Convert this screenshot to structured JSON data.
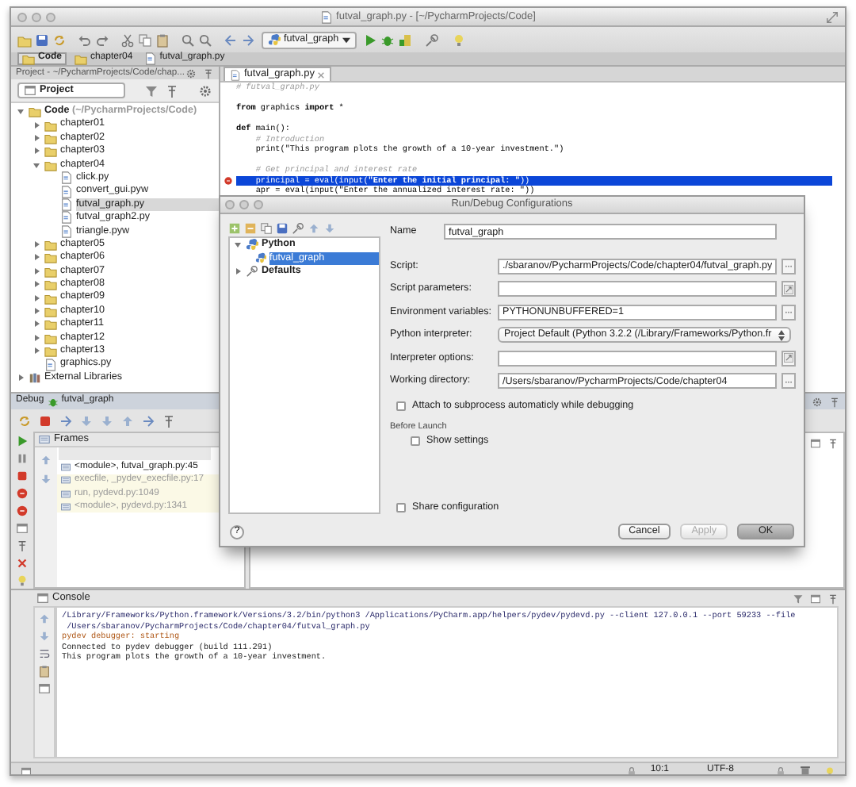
{
  "window": {
    "title": "futval_graph.py - [~/PycharmProjects/Code]"
  },
  "toolbar": {
    "run_config": "futval_graph"
  },
  "breadcrumbs": [
    {
      "label": "Code",
      "kind": "folder",
      "current": true
    },
    {
      "label": "chapter04",
      "kind": "folder",
      "current": false
    },
    {
      "label": "futval_graph.py",
      "kind": "file",
      "current": false
    }
  ],
  "project_panel": {
    "header": "Project - ~/PycharmProjects/Code/chap...",
    "view": "Project",
    "tree": [
      {
        "label": "Code",
        "note": "(~/PycharmProjects/Code)",
        "kind": "folder",
        "expanded": true,
        "selected": false,
        "children": [
          {
            "label": "chapter01",
            "kind": "folder",
            "expanded": false,
            "selected": false
          },
          {
            "label": "chapter02",
            "kind": "folder",
            "expanded": false,
            "selected": false
          },
          {
            "label": "chapter03",
            "kind": "folder",
            "expanded": false,
            "selected": false
          },
          {
            "label": "chapter04",
            "kind": "folder",
            "expanded": true,
            "selected": false,
            "children": [
              {
                "label": "click.py",
                "kind": "file",
                "selected": false
              },
              {
                "label": "convert_gui.pyw",
                "kind": "file",
                "selected": false
              },
              {
                "label": "futval_graph.py",
                "kind": "file",
                "selected": true
              },
              {
                "label": "futval_graph2.py",
                "kind": "file",
                "selected": false
              },
              {
                "label": "triangle.pyw",
                "kind": "file",
                "selected": false
              }
            ]
          },
          {
            "label": "chapter05",
            "kind": "folder",
            "expanded": false,
            "selected": false
          },
          {
            "label": "chapter06",
            "kind": "folder",
            "expanded": false,
            "selected": false
          },
          {
            "label": "chapter07",
            "kind": "folder",
            "expanded": false,
            "selected": false
          },
          {
            "label": "chapter08",
            "kind": "folder",
            "expanded": false,
            "selected": false
          },
          {
            "label": "chapter09",
            "kind": "folder",
            "expanded": false,
            "selected": false
          },
          {
            "label": "chapter10",
            "kind": "folder",
            "expanded": false,
            "selected": false
          },
          {
            "label": "chapter11",
            "kind": "folder",
            "expanded": false,
            "selected": false
          },
          {
            "label": "chapter12",
            "kind": "folder",
            "expanded": false,
            "selected": false
          },
          {
            "label": "chapter13",
            "kind": "folder",
            "expanded": false,
            "selected": false
          },
          {
            "label": "graphics.py",
            "kind": "file",
            "selected": false
          }
        ]
      },
      {
        "label": "External Libraries",
        "kind": "library",
        "expanded": false,
        "selected": false
      }
    ]
  },
  "editor": {
    "tab": "futval_graph.py",
    "lines": [
      {
        "kind": "comment",
        "text": "# futval_graph.py",
        "breakpoint": false,
        "current": false
      },
      {
        "kind": "blank"
      },
      {
        "kind": "code",
        "text": "**from** graphics **import** *",
        "breakpoint": false,
        "current": false
      },
      {
        "kind": "blank"
      },
      {
        "kind": "code",
        "text": "**def** main():",
        "breakpoint": false,
        "current": false
      },
      {
        "kind": "comment",
        "text": "    # Introduction",
        "breakpoint": false,
        "current": false
      },
      {
        "kind": "code",
        "text": "    print(\"This program plots the growth of a 10-year investment.\")",
        "breakpoint": false,
        "current": false
      },
      {
        "kind": "blank"
      },
      {
        "kind": "comment",
        "text": "    # Get principal and interest rate",
        "breakpoint": false,
        "current": false
      },
      {
        "kind": "code",
        "text": "    principal = eval(input(**\"Enter the initial principal: \"**))",
        "breakpoint": true,
        "current": true
      },
      {
        "kind": "code",
        "text": "    apr = eval(input(\"Enter the annualized interest rate: \"))",
        "breakpoint": false,
        "current": false
      }
    ]
  },
  "debug_panel": {
    "title": "Debug",
    "config": "futval_graph",
    "frames_title": "Frames",
    "frames": [
      {
        "label": "<module>, futval_graph.py:45",
        "kind": "user"
      },
      {
        "label": "execfile, _pydev_execfile.py:17",
        "kind": "library"
      },
      {
        "label": "run, pydevd.py:1049",
        "kind": "library"
      },
      {
        "label": "<module>, pydevd.py:1341",
        "kind": "library"
      }
    ]
  },
  "console": {
    "title": "Console",
    "lines": [
      {
        "kind": "command",
        "text": "/Library/Frameworks/Python.framework/Versions/3.2/bin/python3 /Applications/PyCharm.app/helpers/pydev/pydevd.py --client 127.0.0.1 --port 59233 --file"
      },
      {
        "kind": "command",
        "text": " /Users/sbaranov/PycharmProjects/Code/chapter04/futval_graph.py"
      },
      {
        "kind": "stderr",
        "text": "pydev debugger: starting"
      },
      {
        "kind": "stdout",
        "text": "Connected to pydev debugger (build 111.291)"
      },
      {
        "kind": "stdout",
        "text": "This program plots the growth of a 10-year investment."
      }
    ]
  },
  "status_bar": {
    "position": "10:1",
    "encoding": "UTF-8"
  },
  "dialog": {
    "title": "Run/Debug Configurations",
    "tree": [
      {
        "label": "Python",
        "expanded": true,
        "selected": false,
        "children": [
          {
            "label": "futval_graph",
            "selected": true
          }
        ]
      },
      {
        "label": "Defaults",
        "expanded": false,
        "selected": false
      }
    ],
    "fields": [
      {
        "kind": "name",
        "label": "Name",
        "value": "futval_graph",
        "browse": false,
        "expand": false
      },
      {
        "kind": "text",
        "label": "Script:",
        "value": "./sbaranov/PycharmProjects/Code/chapter04/futval_graph.py",
        "browse": true,
        "expand": false
      },
      {
        "kind": "text",
        "label": "Script parameters:",
        "browse": false,
        "expand": true
      },
      {
        "kind": "text",
        "label": "Environment variables:",
        "value": "PYTHONUNBUFFERED=1",
        "browse": true,
        "expand": false
      },
      {
        "kind": "select",
        "label": "Python interpreter:",
        "value": "Project Default (Python 3.2.2 (/Library/Frameworks/Python.fr",
        "browse": false,
        "expand": false
      },
      {
        "kind": "text",
        "label": "Interpreter options:",
        "browse": false,
        "expand": true
      },
      {
        "kind": "text",
        "label": "Working directory:",
        "value": "/Users/sbaranov/PycharmProjects/Code/chapter04",
        "browse": true,
        "expand": false
      }
    ],
    "attach": {
      "label": "Attach to subprocess automaticly while debugging",
      "checked": false
    },
    "before_launch": {
      "title": "Before Launch",
      "show_settings": {
        "label": "Show settings",
        "checked": false
      }
    },
    "share": {
      "label": "Share configuration",
      "checked": false
    },
    "help": "?",
    "buttons": [
      {
        "label": "Cancel",
        "disabled": false,
        "default": false
      },
      {
        "label": "Apply",
        "disabled": true,
        "default": false
      },
      {
        "label": "OK",
        "disabled": false,
        "default": true
      }
    ]
  }
}
